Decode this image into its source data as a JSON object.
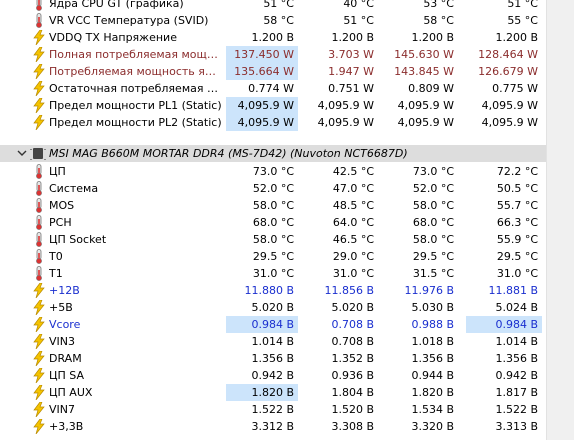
{
  "top_section": {
    "rows": [
      {
        "icon": "thermometer-icon",
        "label": "Ядра CPU GT (графика)",
        "values": [
          "51 °C",
          "40 °C",
          "53 °C",
          "51 °C"
        ],
        "color": "normal",
        "hl": []
      },
      {
        "icon": "thermometer-icon",
        "label": "VR VCC Температура (SVID)",
        "values": [
          "58 °C",
          "51 °C",
          "58 °C",
          "55 °C"
        ],
        "color": "normal",
        "hl": []
      },
      {
        "icon": "bolt-icon",
        "label": "VDDQ TX Напряжение",
        "values": [
          "1.200 В",
          "1.200 В",
          "1.200 В",
          "1.200 В"
        ],
        "color": "normal",
        "hl": []
      },
      {
        "icon": "bolt-icon",
        "label": "Полная потребляемая мощност...",
        "values": [
          "137.450 W",
          "3.703 W",
          "145.630 W",
          "128.464 W"
        ],
        "color": "red",
        "hl": [
          0
        ]
      },
      {
        "icon": "bolt-icon",
        "label": "Потребляемая мощность ядер IA",
        "values": [
          "135.664 W",
          "1.947 W",
          "143.845 W",
          "126.679 W"
        ],
        "color": "red",
        "hl": [
          0
        ]
      },
      {
        "icon": "bolt-icon",
        "label": "Остаточная потребляемая мощ...",
        "values": [
          "0.774 W",
          "0.751 W",
          "0.809 W",
          "0.775 W"
        ],
        "color": "normal",
        "hl": []
      },
      {
        "icon": "bolt-icon",
        "label": "Предел мощности PL1 (Static)",
        "values": [
          "4,095.9 W",
          "4,095.9 W",
          "4,095.9 W",
          "4,095.9 W"
        ],
        "color": "normal",
        "hl": [
          0
        ]
      },
      {
        "icon": "bolt-icon",
        "label": "Предел мощности PL2 (Static)",
        "values": [
          "4,095.9 W",
          "4,095.9 W",
          "4,095.9 W",
          "4,095.9 W"
        ],
        "color": "normal",
        "hl": [
          0
        ]
      }
    ]
  },
  "group": {
    "title": "MSI MAG B660M MORTAR DDR4 (MS-7D42) (Nuvoton NCT6687D)",
    "rows": [
      {
        "icon": "thermometer-icon",
        "label": "ЦП",
        "values": [
          "73.0 °C",
          "42.5 °C",
          "73.0 °C",
          "72.2 °C"
        ],
        "color": "normal",
        "hl": []
      },
      {
        "icon": "thermometer-icon",
        "label": "Система",
        "values": [
          "52.0 °C",
          "47.0 °C",
          "52.0 °C",
          "50.5 °C"
        ],
        "color": "normal",
        "hl": []
      },
      {
        "icon": "thermometer-icon",
        "label": "MOS",
        "values": [
          "58.0 °C",
          "48.5 °C",
          "58.0 °C",
          "55.7 °C"
        ],
        "color": "normal",
        "hl": []
      },
      {
        "icon": "thermometer-icon",
        "label": "PCH",
        "values": [
          "68.0 °C",
          "64.0 °C",
          "68.0 °C",
          "66.3 °C"
        ],
        "color": "normal",
        "hl": []
      },
      {
        "icon": "thermometer-icon",
        "label": "ЦП Socket",
        "values": [
          "58.0 °C",
          "46.5 °C",
          "58.0 °C",
          "55.9 °C"
        ],
        "color": "normal",
        "hl": []
      },
      {
        "icon": "thermometer-icon",
        "label": "T0",
        "values": [
          "29.5 °C",
          "29.0 °C",
          "29.5 °C",
          "29.5 °C"
        ],
        "color": "normal",
        "hl": []
      },
      {
        "icon": "thermometer-icon",
        "label": "T1",
        "values": [
          "31.0 °C",
          "31.0 °C",
          "31.5 °C",
          "31.0 °C"
        ],
        "color": "normal",
        "hl": []
      },
      {
        "icon": "bolt-icon",
        "label": "+12В",
        "values": [
          "11.880 В",
          "11.856 В",
          "11.976 В",
          "11.881 В"
        ],
        "color": "blue",
        "hl": []
      },
      {
        "icon": "bolt-icon",
        "label": "+5В",
        "values": [
          "5.020 В",
          "5.020 В",
          "5.030 В",
          "5.024 В"
        ],
        "color": "normal",
        "hl": []
      },
      {
        "icon": "bolt-icon",
        "label": "Vcore",
        "values": [
          "0.984 В",
          "0.708 В",
          "0.988 В",
          "0.984 В"
        ],
        "color": "blue",
        "hl": [
          0,
          3
        ]
      },
      {
        "icon": "bolt-icon",
        "label": "VIN3",
        "values": [
          "1.014 В",
          "0.708 В",
          "1.018 В",
          "1.014 В"
        ],
        "color": "normal",
        "hl": []
      },
      {
        "icon": "bolt-icon",
        "label": "DRAM",
        "values": [
          "1.356 В",
          "1.352 В",
          "1.356 В",
          "1.356 В"
        ],
        "color": "normal",
        "hl": []
      },
      {
        "icon": "bolt-icon",
        "label": "ЦП SA",
        "values": [
          "0.942 В",
          "0.936 В",
          "0.944 В",
          "0.942 В"
        ],
        "color": "normal",
        "hl": []
      },
      {
        "icon": "bolt-icon",
        "label": "ЦП AUX",
        "values": [
          "1.820 В",
          "1.804 В",
          "1.820 В",
          "1.817 В"
        ],
        "color": "normal",
        "hl": [
          0
        ]
      },
      {
        "icon": "bolt-icon",
        "label": "VIN7",
        "values": [
          "1.522 В",
          "1.520 В",
          "1.534 В",
          "1.522 В"
        ],
        "color": "normal",
        "hl": []
      },
      {
        "icon": "bolt-icon",
        "label": "+3,3В",
        "values": [
          "3.312 В",
          "3.308 В",
          "3.320 В",
          "3.313 В"
        ],
        "color": "normal",
        "hl": []
      }
    ]
  },
  "colors": {
    "highlight": "#cce4fb",
    "red_text": "#8b2d2d",
    "blue_text": "#1a2fcf",
    "group_bg": "#dddddd"
  }
}
